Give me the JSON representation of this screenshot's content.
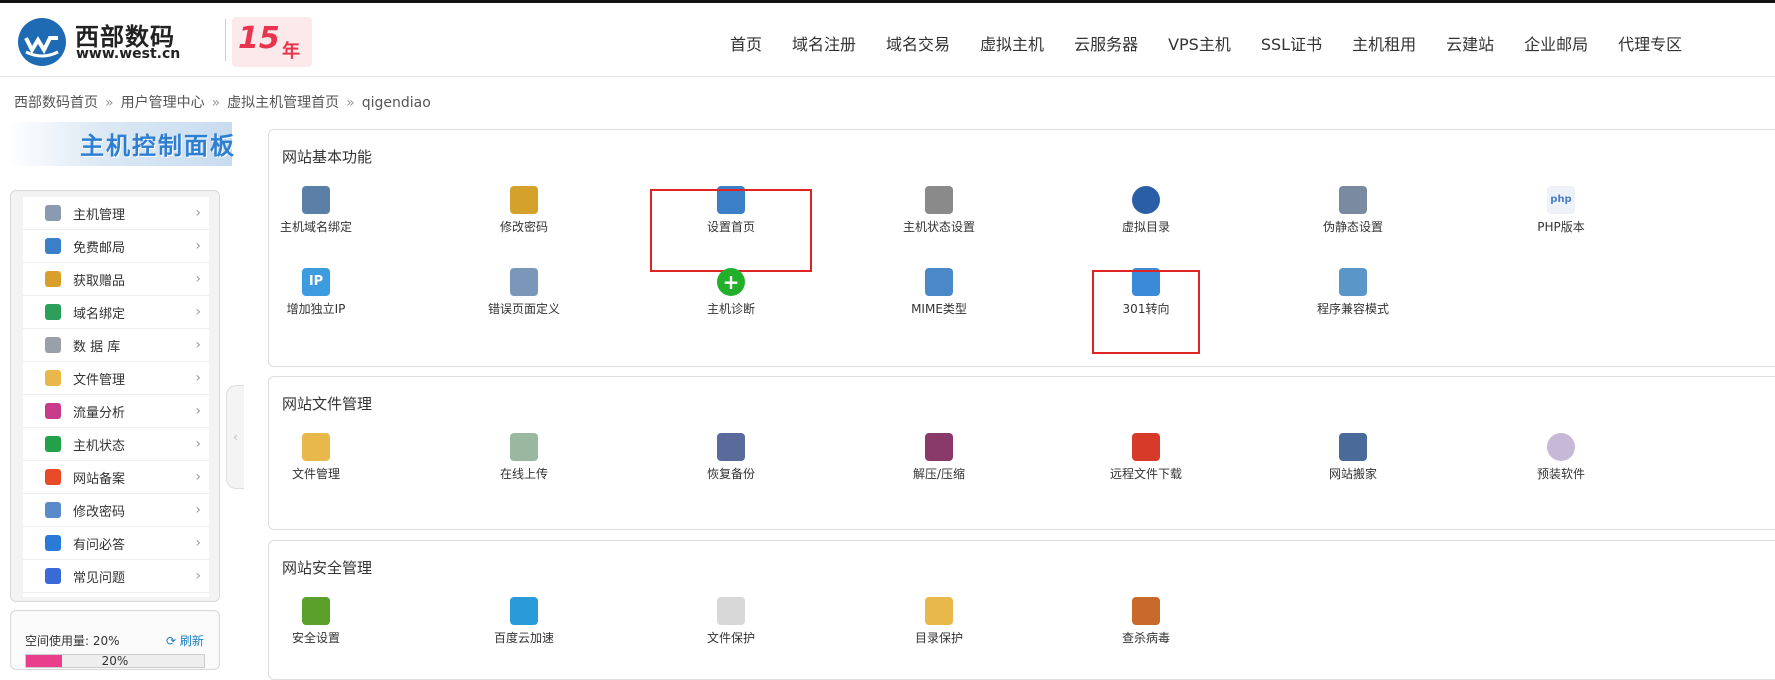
{
  "header": {
    "logo_name": "西部数码",
    "logo_url": "www.west.cn",
    "anniversary": "15",
    "anniversary_suffix": "年",
    "nav": [
      "首页",
      "域名注册",
      "域名交易",
      "虚拟主机",
      "云服务器",
      "VPS主机",
      "SSL证书",
      "主机租用",
      "云建站",
      "企业邮局",
      "代理专区"
    ]
  },
  "breadcrumb": [
    "西部数码首页",
    "用户管理中心",
    "虚拟主机管理首页",
    "qigendiao"
  ],
  "breadcrumb_sep": "»",
  "panel_title": "主机控制面板",
  "sidebar": {
    "items": [
      {
        "label": "主机管理",
        "icon": "server-icon"
      },
      {
        "label": "免费邮局",
        "icon": "mail-icon"
      },
      {
        "label": "获取赠品",
        "icon": "gift-icon"
      },
      {
        "label": "域名绑定",
        "icon": "globe-icon"
      },
      {
        "label": "数 据 库",
        "icon": "database-icon"
      },
      {
        "label": "文件管理",
        "icon": "folder-icon"
      },
      {
        "label": "流量分析",
        "icon": "chart-icon"
      },
      {
        "label": "主机状态",
        "icon": "status-icon"
      },
      {
        "label": "网站备案",
        "icon": "record-icon"
      },
      {
        "label": "修改密码",
        "icon": "key-icon"
      },
      {
        "label": "有问必答",
        "icon": "support-icon"
      },
      {
        "label": "常见问题",
        "icon": "faq-icon"
      }
    ],
    "arrow": "›",
    "collapse": "‹"
  },
  "usage": {
    "label": "空间使用量: 20%",
    "refresh": "刷新",
    "percent_text": "20%",
    "percent": 20
  },
  "sections": [
    {
      "title": "网站基本功能",
      "tools": [
        {
          "label": "主机域名绑定",
          "icon": "host-domain-icon",
          "color": "#5b7fa6"
        },
        {
          "label": "修改密码",
          "icon": "lock-icon",
          "color": "#d4a22a"
        },
        {
          "label": "设置首页",
          "icon": "homepage-icon",
          "color": "#3a7fc8",
          "highlight": true
        },
        {
          "label": "主机状态设置",
          "icon": "gear-icon",
          "color": "#8a8a8a"
        },
        {
          "label": "虚拟目录",
          "icon": "clock-icon",
          "color": "#2a5fa8"
        },
        {
          "label": "伪静态设置",
          "icon": "document-icon",
          "color": "#7a8aa0"
        },
        {
          "label": "PHP版本",
          "icon": "php-icon",
          "color": "#4a7fc8"
        },
        {
          "label": "增加独立IP",
          "icon": "ip-icon",
          "color": "#3d9be0"
        },
        {
          "label": "错误页面定义",
          "icon": "error-page-icon",
          "color": "#7a96b8"
        },
        {
          "label": "主机诊断",
          "icon": "plus-circle-icon",
          "color": "#22b02b"
        },
        {
          "label": "MIME类型",
          "icon": "mime-icon",
          "color": "#4a88c8"
        },
        {
          "label": "301转向",
          "icon": "redirect-icon",
          "color": "#3a8ad8",
          "highlight": true
        },
        {
          "label": "程序兼容模式",
          "icon": "scroll-icon",
          "color": "#5a96c8"
        }
      ]
    },
    {
      "title": "网站文件管理",
      "tools": [
        {
          "label": "文件管理",
          "icon": "folder-key-icon",
          "color": "#e8b84a"
        },
        {
          "label": "在线上传",
          "icon": "upload-icon",
          "color": "#9ab8a0"
        },
        {
          "label": "恢复备份",
          "icon": "restore-icon",
          "color": "#5a6a9a"
        },
        {
          "label": "解压/压缩",
          "icon": "archive-icon",
          "color": "#8a3a6a"
        },
        {
          "label": "远程文件下载",
          "icon": "download-icon",
          "color": "#d83a2a"
        },
        {
          "label": "网站搬家",
          "icon": "move-icon",
          "color": "#4a6a9a"
        },
        {
          "label": "预装软件",
          "icon": "disc-icon",
          "color": "#c8b8d8"
        }
      ]
    },
    {
      "title": "网站安全管理",
      "tools": [
        {
          "label": "安全设置",
          "icon": "shield-icon",
          "color": "#5aa02a"
        },
        {
          "label": "百度云加速",
          "icon": "cloud-icon",
          "color": "#2a9ad8"
        },
        {
          "label": "文件保护",
          "icon": "file-protect-icon",
          "color": "#d8d8d8"
        },
        {
          "label": "目录保护",
          "icon": "folder-protect-icon",
          "color": "#e8b84a"
        },
        {
          "label": "查杀病毒",
          "icon": "bug-icon",
          "color": "#c86a2a"
        }
      ]
    }
  ]
}
